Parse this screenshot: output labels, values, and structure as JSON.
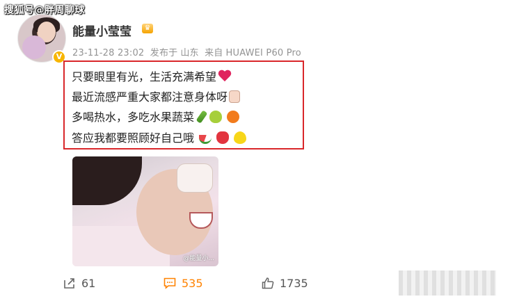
{
  "watermark": "搜狐号@胖周聊球",
  "user": {
    "name": "能量小莹莹",
    "verified": true
  },
  "meta": {
    "time": "23-11-28 23:02",
    "posted_from_prefix": "发布于",
    "location": "山东",
    "device_prefix": "来自",
    "device": "HUAWEI P60 Pro"
  },
  "post": {
    "line1": "只要眼里有光，生活充满希望",
    "line2": "最近流感严重大家都注意身体呀",
    "line3": "多喝热水，多吃水果蔬菜",
    "line4": "答应我都要照顾好自己哦"
  },
  "image": {
    "caption": "@能量小..."
  },
  "actions": {
    "share_count": "61",
    "comment_count": "535",
    "like_count": "1735"
  },
  "colors": {
    "highlight_border": "#d9262a",
    "comment_accent": "#ff8200",
    "verified_badge": "#f7b500"
  }
}
